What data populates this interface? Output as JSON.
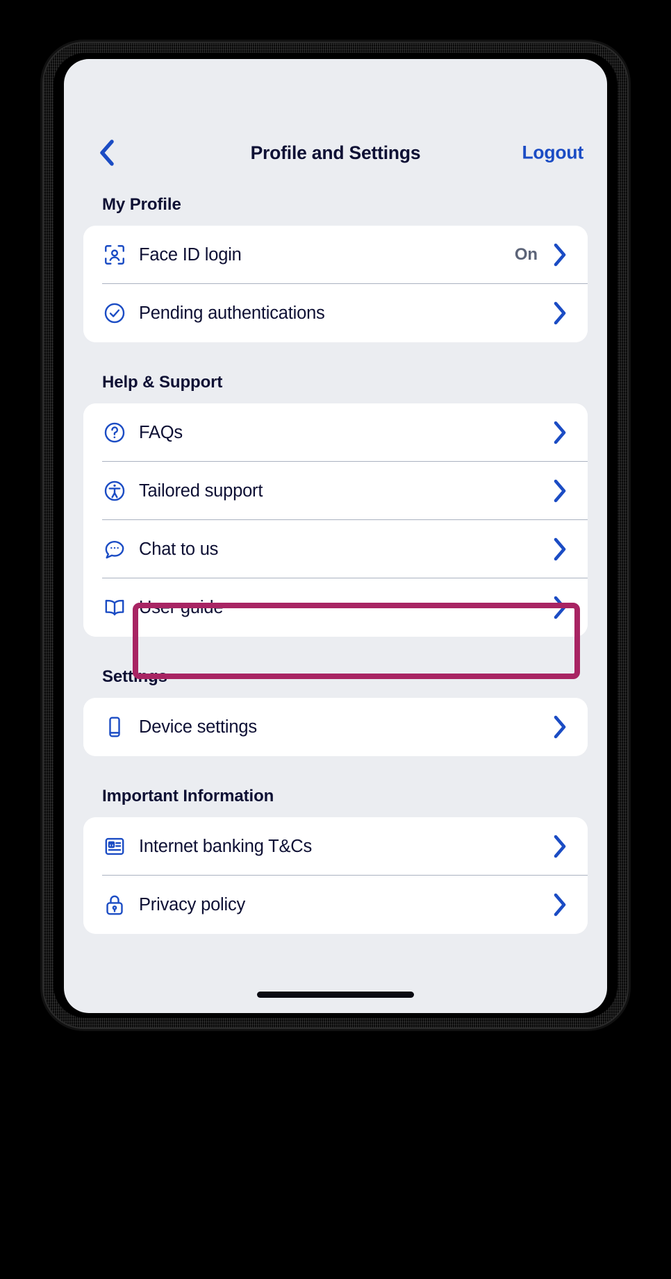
{
  "colors": {
    "screen_background": "#EBEDF1",
    "card_background": "#FFFFFF",
    "text_primary": "#0E1034",
    "accent_blue": "#1B4CC4",
    "value_gray": "#5C6478",
    "highlight_magenta": "#A82463",
    "divider": "#AAB2C0"
  },
  "header": {
    "back_label": "back-chevron",
    "title": "Profile and Settings",
    "logout_label": "Logout"
  },
  "sections": [
    {
      "heading": "My Profile",
      "rows": [
        {
          "icon": "face-id-icon",
          "label": "Face ID login",
          "value": "On",
          "chevron": true
        },
        {
          "icon": "check-circle-icon",
          "label": "Pending authentications",
          "value": "",
          "chevron": true
        }
      ]
    },
    {
      "heading": "Help & Support",
      "rows": [
        {
          "icon": "question-circle-icon",
          "label": "FAQs",
          "value": "",
          "chevron": true
        },
        {
          "icon": "accessibility-icon",
          "label": "Tailored support",
          "value": "",
          "chevron": true
        },
        {
          "icon": "chat-bubble-icon",
          "label": "Chat to us",
          "value": "",
          "chevron": true,
          "highlighted": true
        },
        {
          "icon": "book-icon",
          "label": "User guide",
          "value": "",
          "chevron": true
        }
      ]
    },
    {
      "heading": "Settings",
      "rows": [
        {
          "icon": "mobile-device-icon",
          "label": "Device settings",
          "value": "",
          "chevron": true
        }
      ]
    },
    {
      "heading": "Important Information",
      "rows": [
        {
          "icon": "document-terms-icon",
          "label": "Internet banking T&Cs",
          "value": "",
          "chevron": true
        },
        {
          "icon": "lock-icon",
          "label": "Privacy policy",
          "value": "",
          "chevron": true
        }
      ]
    }
  ],
  "home_indicator": "home-indicator-bar"
}
